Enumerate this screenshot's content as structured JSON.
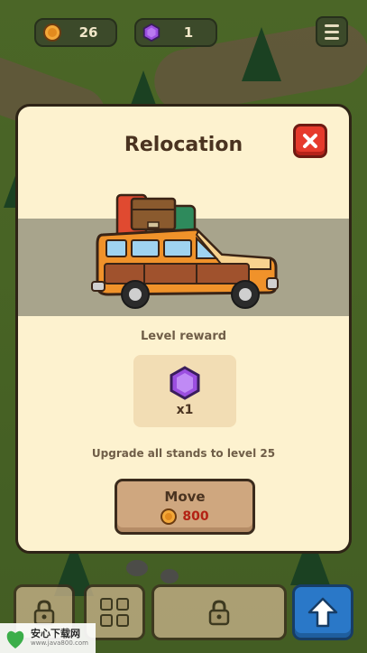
{
  "hud": {
    "coins": "26",
    "gems": "1"
  },
  "modal": {
    "title": "Relocation",
    "reward_label": "Level reward",
    "reward_quantity": "x1",
    "requirement": "Upgrade all stands to level 25",
    "move_label": "Move",
    "move_cost": "800"
  },
  "watermark": {
    "name": "安心下载网",
    "url": "www.java800.com"
  },
  "colors": {
    "panel": "#fdf2cf",
    "close": "#e63a2c",
    "move_button": "#cfa77f",
    "cost_text": "#b32214",
    "gem": "#9b4fe0",
    "coin": "#e28a1e",
    "arrow_button": "#2a78c8"
  },
  "icons": [
    "coin-icon",
    "gem-icon",
    "menu-icon",
    "close-icon",
    "lock-icon",
    "grid-icon",
    "up-arrow-icon"
  ]
}
